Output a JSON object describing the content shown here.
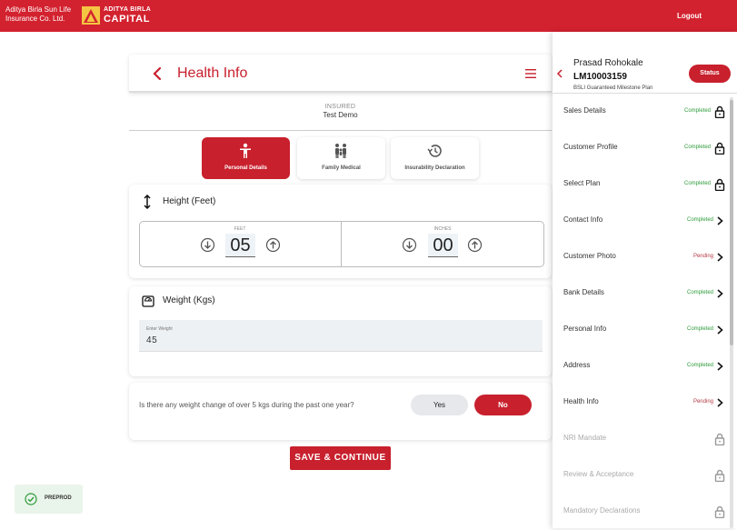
{
  "header": {
    "brand_left_line1": "Aditya Birla Sun Life",
    "brand_left_line2": "Insurance Co. Ltd.",
    "brand_right_line1": "ADITYA BIRLA",
    "brand_right_line2": "CAPITAL",
    "logout_label": "Logout"
  },
  "page": {
    "title": "Health Info",
    "insured_label": "INSURED",
    "insured_name": "Test Demo"
  },
  "tabs": [
    {
      "label": "Personal Details",
      "icon": "person-icon",
      "active": true
    },
    {
      "label": "Family Medical",
      "icon": "family-icon",
      "active": false
    },
    {
      "label": "Insurability Declaration",
      "icon": "history-icon",
      "active": false
    }
  ],
  "height": {
    "title": "Height (Feet)",
    "feet_label": "FEET",
    "feet_value": "05",
    "inches_label": "INCHES",
    "inches_value": "00"
  },
  "weight": {
    "title": "Weight (Kgs)",
    "placeholder": "Enter Weight",
    "value": "45"
  },
  "question": {
    "text": "Is there any weight change of over 5 kgs during the past one year?",
    "yes_label": "Yes",
    "no_label": "No",
    "selected": "No"
  },
  "save_label": "SAVE & CONTINUE",
  "env_badge": "PREPROD",
  "sidebar": {
    "customer_name": "Prasad Rohokale",
    "customer_id": "LM10003159",
    "plan": "BSLI Guaranteed Milestone Plan",
    "status_label": "Status",
    "steps": [
      {
        "name": "Sales Details",
        "status": "Completed",
        "icon": "lock-icon"
      },
      {
        "name": "Customer Profile",
        "status": "Completed",
        "icon": "lock-icon"
      },
      {
        "name": "Select Plan",
        "status": "Completed",
        "icon": "lock-icon"
      },
      {
        "name": "Contact Info",
        "status": "Completed",
        "icon": "chevron-right-icon"
      },
      {
        "name": "Customer Photo",
        "status": "Pending",
        "icon": "chevron-right-icon"
      },
      {
        "name": "Bank Details",
        "status": "Completed",
        "icon": "chevron-right-icon"
      },
      {
        "name": "Personal Info",
        "status": "Completed",
        "icon": "chevron-right-icon"
      },
      {
        "name": "Address",
        "status": "Completed",
        "icon": "chevron-right-icon"
      },
      {
        "name": "Health Info",
        "status": "Pending",
        "icon": "chevron-right-icon"
      },
      {
        "name": "NRI Mandate",
        "status": "",
        "icon": "lock-icon"
      },
      {
        "name": "Review & Acceptance",
        "status": "",
        "icon": "lock-icon"
      },
      {
        "name": "Mandatory Declarations",
        "status": "",
        "icon": "lock-icon"
      }
    ]
  },
  "colors": {
    "brand_red": "#d3222f",
    "accent_red": "#c8202d",
    "completed_green": "#2e9b3a",
    "pending_red": "#b33a42"
  }
}
